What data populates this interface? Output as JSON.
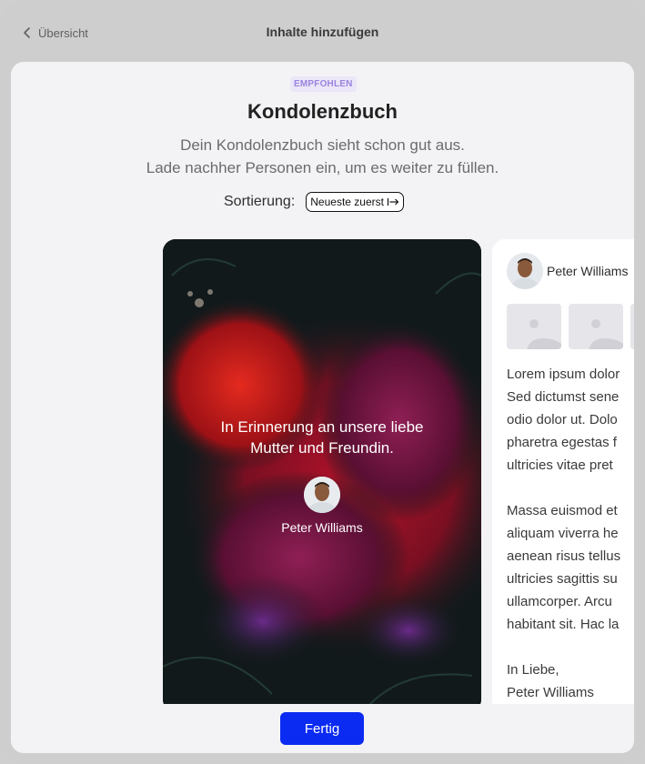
{
  "nav": {
    "back_label": "Übersicht",
    "title": "Inhalte hinzufügen"
  },
  "main": {
    "badge": "EMPFOHLEN",
    "title": "Kondolenzbuch",
    "subtitle_line1": "Dein Kondolenzbuch sieht schon gut aus.",
    "subtitle_line2": "Lade nachher Personen ein, um es weiter zu füllen.",
    "sort_label": "Sortierung:",
    "sort_value": "Neueste zuerst"
  },
  "cover": {
    "text_line1": "In Erinnerung an unsere liebe",
    "text_line2": "Mutter und Freundin.",
    "name": "Peter Williams"
  },
  "message": {
    "author": "Peter Williams",
    "lines_p1": [
      "Lorem ipsum dolor",
      "Sed dictumst sene",
      "odio dolor ut. Dolo",
      "pharetra egestas f",
      "ultricies vitae pret"
    ],
    "lines_p2": [
      "Massa euismod et",
      "aliquam viverra he",
      "aenean risus tellus",
      "ultricies sagittis su",
      "ullamcorper. Arcu",
      "habitant sit. Hac la"
    ],
    "closing": "In Liebe,",
    "signature": "Peter Williams"
  },
  "footer": {
    "done_label": "Fertig"
  },
  "colors": {
    "accent": "#0b2bf2",
    "badge_bg": "#ebe6f8",
    "badge_text": "#9b83de"
  }
}
